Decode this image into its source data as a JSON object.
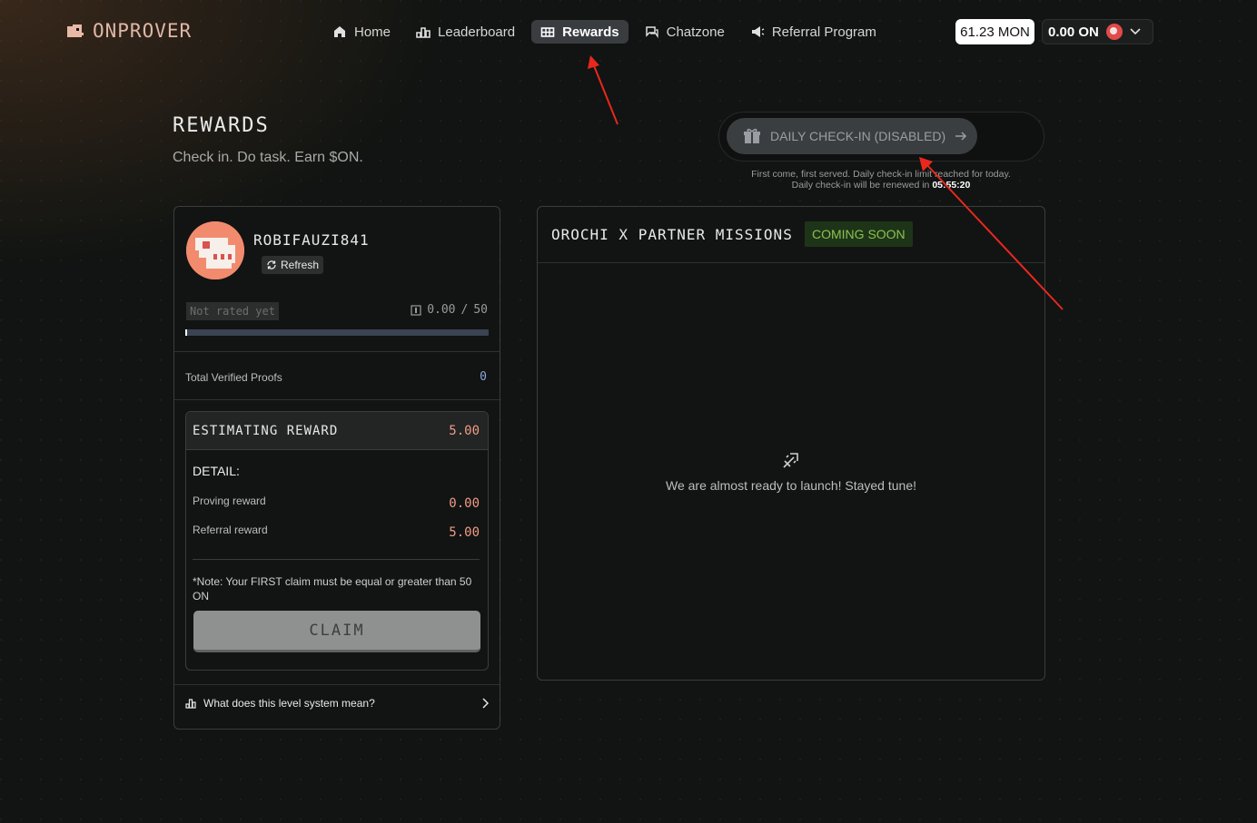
{
  "header": {
    "logo_text": "ONPROVER",
    "nav": [
      {
        "label": "Home",
        "icon": "home-icon"
      },
      {
        "label": "Leaderboard",
        "icon": "podium-icon"
      },
      {
        "label": "Rewards",
        "icon": "gift-box-icon",
        "active": true
      },
      {
        "label": "Chatzone",
        "icon": "chat-icon"
      },
      {
        "label": "Referral Program",
        "icon": "megaphone-icon"
      }
    ],
    "balance_mon": "61.23 MON",
    "balance_on": "0.00 ON"
  },
  "page": {
    "title": "REWARDS",
    "subtitle": "Check in. Do task. Earn $ON."
  },
  "checkin": {
    "button_label": "DAILY CHECK-IN (DISABLED)",
    "note_line1": "First come, first served. Daily check-in limit reached for today.",
    "note_line2_prefix": "Daily check-in will be renewed in",
    "countdown": "05:55:20"
  },
  "profile": {
    "username": "ROBIFAUZI841",
    "refresh_label": "Refresh",
    "rating": "Not rated yet",
    "score_current": "0.00",
    "score_separator": "/",
    "score_max": "50",
    "progress_fraction": 0.0,
    "total_proofs_label": "Total Verified Proofs",
    "total_proofs_value": "0",
    "estimating": {
      "title": "ESTIMATING REWARD",
      "value": "5.00",
      "detail_label": "DETAIL:",
      "proving_label": "Proving reward",
      "proving_value": "0.00",
      "referral_label": "Referral reward",
      "referral_value": "5.00",
      "note": "*Note: Your FIRST claim must be equal or greater than 50 ON",
      "claim_label": "CLAIM"
    },
    "level_link": "What does this level system mean?"
  },
  "missions": {
    "title": "OROCHI X PARTNER MISSIONS",
    "badge": "COMING SOON",
    "empty_message": "We are almost ready to launch! Stayed tune!"
  },
  "colors": {
    "accent_salmon": "#f29b86",
    "badge_green": "#8bc24f",
    "annotation_red": "#e8281e"
  }
}
